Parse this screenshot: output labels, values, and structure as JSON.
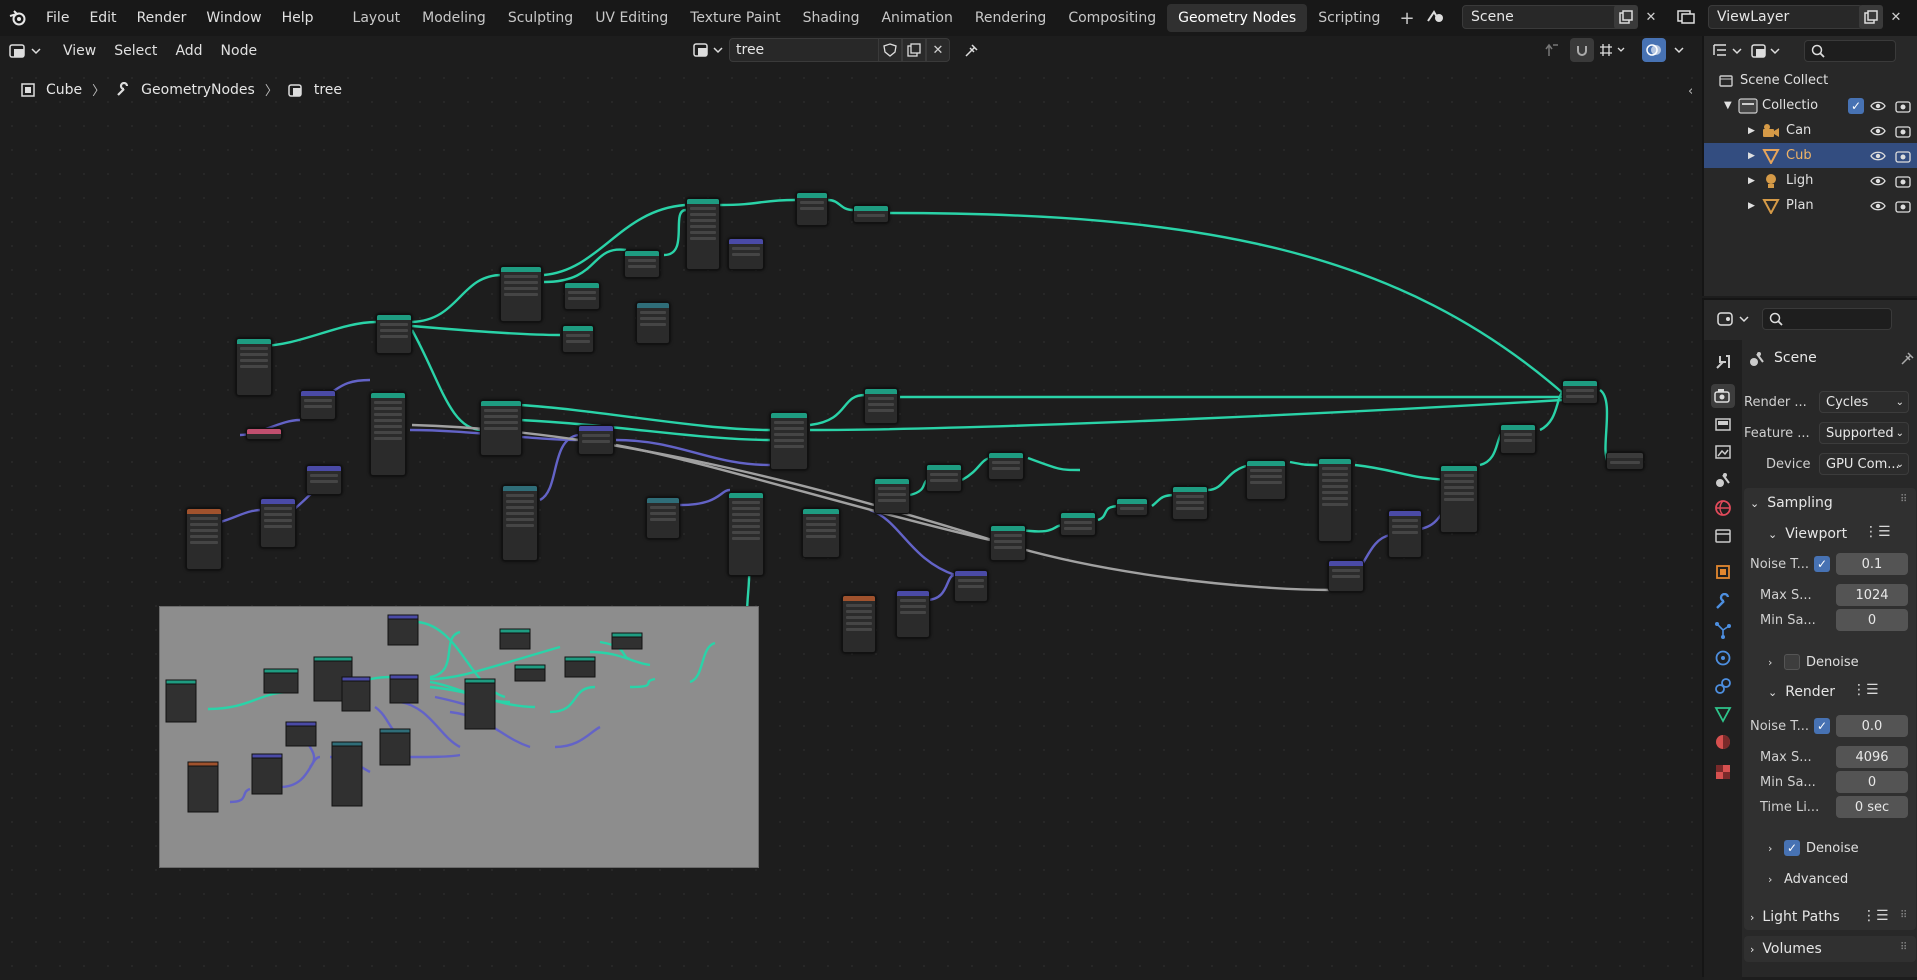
{
  "app": {
    "menus": [
      "File",
      "Edit",
      "Render",
      "Window",
      "Help"
    ],
    "workspaces": [
      "Layout",
      "Modeling",
      "Sculpting",
      "UV Editing",
      "Texture Paint",
      "Shading",
      "Animation",
      "Rendering",
      "Compositing",
      "Geometry Nodes",
      "Scripting"
    ],
    "active_workspace": "Geometry Nodes",
    "scene_name": "Scene",
    "view_layer": "ViewLayer"
  },
  "editor": {
    "menus": [
      "View",
      "Select",
      "Add",
      "Node"
    ],
    "node_tree": "tree",
    "breadcrumb": [
      "Cube",
      "GeometryNodes",
      "tree"
    ]
  },
  "outliner": {
    "rows": [
      {
        "label": "Scene Collection"
      },
      {
        "label": "Collection"
      },
      {
        "label": "Camera"
      },
      {
        "label": "Cube",
        "selected": true
      },
      {
        "label": "Light"
      },
      {
        "label": "Plane"
      }
    ],
    "row_labels": [
      "Scene Collect",
      "Collectio",
      "Can",
      "Cub",
      "Ligh",
      "Plan"
    ]
  },
  "properties": {
    "title": "Scene",
    "render_engine_label": "Render ...",
    "render_engine": "Cycles",
    "feature_set_label": "Feature ...",
    "feature_set": "Supported",
    "device_label": "Device",
    "device": "GPU Com...",
    "sampling": {
      "header": "Sampling",
      "viewport": {
        "header": "Viewport",
        "noise_threshold_label": "Noise T...",
        "noise_threshold": "0.1",
        "max_samples_label": "Max S...",
        "max_samples": "1024",
        "min_samples_label": "Min Sa...",
        "min_samples": "0",
        "denoise_label": "Denoise",
        "denoise": false
      },
      "render": {
        "header": "Render",
        "noise_threshold_label": "Noise T...",
        "noise_threshold": "0.0",
        "max_samples_label": "Max S...",
        "max_samples": "4096",
        "min_samples_label": "Min Sa...",
        "min_samples": "0",
        "time_limit_label": "Time Li...",
        "time_limit": "0 sec",
        "denoise_label": "Denoise",
        "denoise": true
      },
      "advanced_label": "Advanced"
    },
    "light_paths_label": "Light Paths",
    "volumes_label": "Volumes"
  },
  "colors": {
    "link_geometry": "#2ad3a8",
    "link_vector": "#6363c7",
    "link_float": "#a1a1a1",
    "selection": "#334d80",
    "checkbox": "#4772b3"
  }
}
